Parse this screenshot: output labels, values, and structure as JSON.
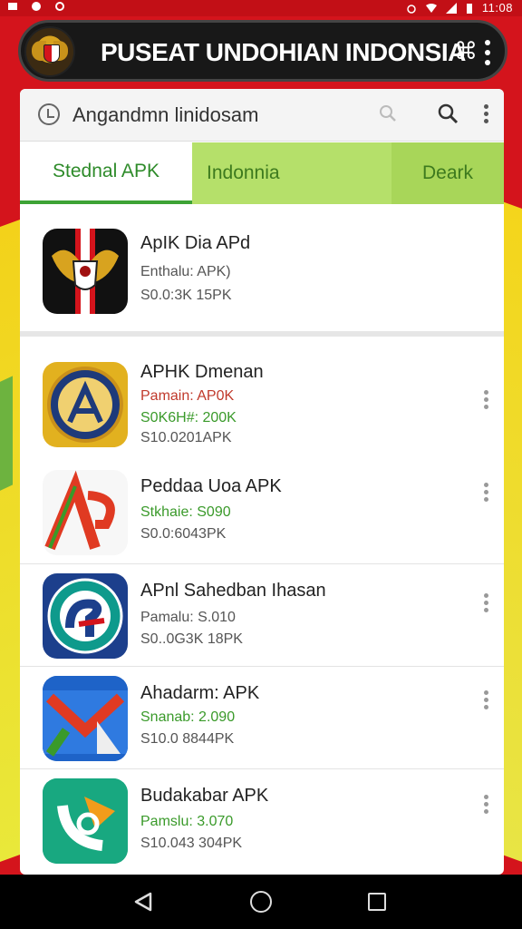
{
  "status_bar": {
    "time": "11:08"
  },
  "header": {
    "title": "PUSEAT UNDOHIAN INDONSIA",
    "glyph": "⌘"
  },
  "search": {
    "text": "Angandmn linidosam"
  },
  "tabs": [
    {
      "label": "Stednal APK"
    },
    {
      "label": "Indonnia"
    },
    {
      "label": "Deark"
    }
  ],
  "featured": {
    "title": "ApIK Dia APd",
    "line1": "Enthalu: APK)",
    "line2": "S0.0:3K 15PK"
  },
  "apps": [
    {
      "title": "APHK Dmenan",
      "line1": "Pamain: AP0K",
      "line2": "S0K6H#: 200K",
      "line3": "S10.0201APK",
      "icon": "golden-a-icon",
      "line1_color": "#c0392b",
      "line2_color": "#3a9a2a"
    },
    {
      "title": "Peddaa Uoa APK",
      "line1": "Stkhaie: S090",
      "line2": "S0.0:6043PK",
      "icon": "red-ap-icon",
      "line1_color": "#3a9a2a"
    },
    {
      "title": "APnl Sahedban Ihasan",
      "line1": "Pamalu: S.010",
      "line2": "S0..0G3K 18PK",
      "icon": "circle-emblem-icon",
      "line1_color": "#555555"
    },
    {
      "title": "Ahadarm: APK",
      "line1": "Snanab: 2.090",
      "line2": "S10.0 8844PK",
      "icon": "mail-m-icon",
      "line1_color": "#3a9a2a"
    },
    {
      "title": "Budakabar APK",
      "line1": "Pamslu: 3.070",
      "line2": "S10.043 304PK",
      "icon": "phone-icon",
      "line1_color": "#3a9a2a"
    }
  ],
  "colors": {
    "brand_red": "#d4141c",
    "green_tab": "#b5e06a",
    "accent_green": "#3da335"
  }
}
